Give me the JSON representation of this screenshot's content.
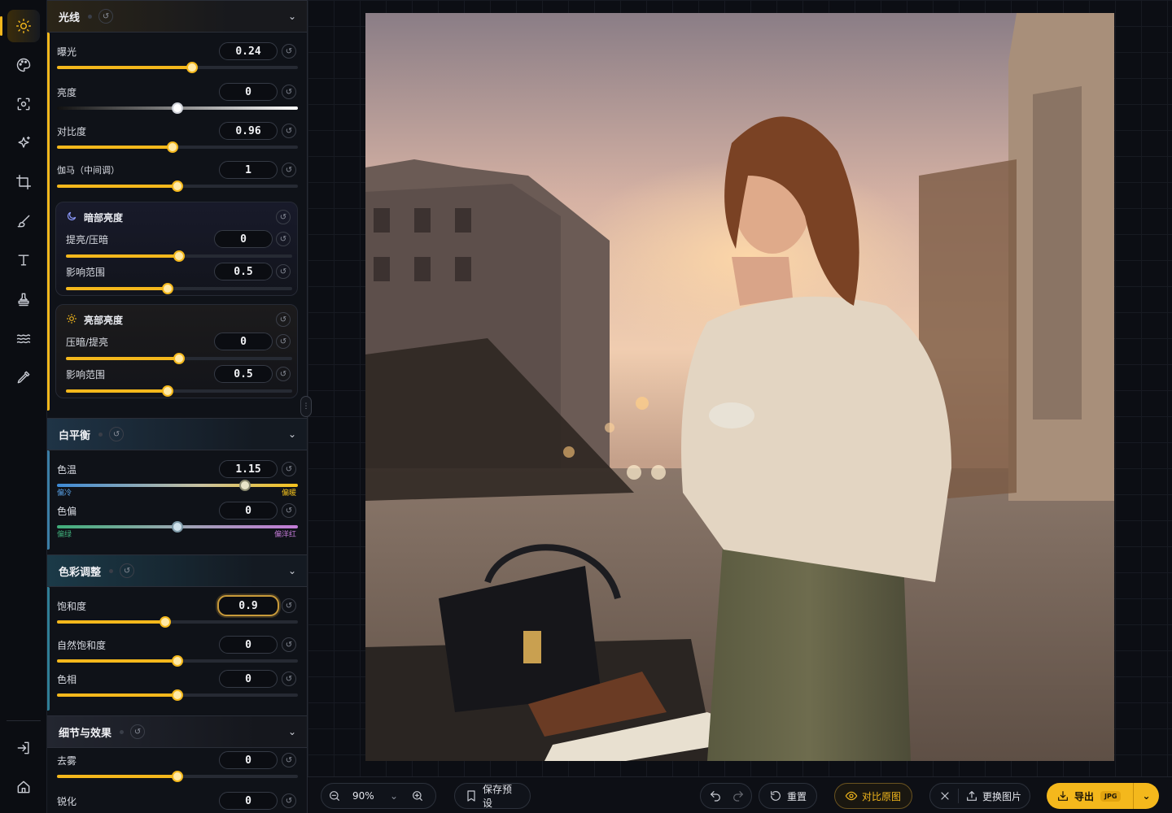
{
  "rail": {
    "tools": [
      "sun-icon",
      "palette-icon",
      "focus-icon",
      "sparkle-icon",
      "crop-icon",
      "brush-icon",
      "text-icon",
      "stamp-icon",
      "waves-icon",
      "eyedropper-icon"
    ],
    "bottom": [
      "exit-icon",
      "home-icon"
    ]
  },
  "light": {
    "title": "光线",
    "exposure": {
      "label": "曝光",
      "value": "0.24",
      "level": 0.56
    },
    "brightness": {
      "label": "亮度",
      "value": "0",
      "level": 0.5
    },
    "contrast": {
      "label": "对比度",
      "value": "0.96",
      "level": 0.48
    },
    "gamma": {
      "label": "伽马（中间调）",
      "value": "1",
      "level": 0.5
    },
    "shadows": {
      "title": "暗部亮度",
      "lift": {
        "label": "提亮/压暗",
        "value": "0",
        "level": 0.5
      },
      "range": {
        "label": "影响范围",
        "value": "0.5",
        "level": 0.45
      }
    },
    "highlights": {
      "title": "亮部亮度",
      "lift": {
        "label": "压暗/提亮",
        "value": "0",
        "level": 0.5
      },
      "range": {
        "label": "影响范围",
        "value": "0.5",
        "level": 0.45
      }
    }
  },
  "white_balance": {
    "title": "白平衡",
    "temperature": {
      "label": "色温",
      "value": "1.15",
      "level": 0.78,
      "min_label": "偏冷",
      "max_label": "偏暖"
    },
    "tint": {
      "label": "色偏",
      "value": "0",
      "level": 0.5,
      "min_label": "偏绿",
      "max_label": "偏洋红"
    }
  },
  "color": {
    "title": "色彩调整",
    "saturation": {
      "label": "饱和度",
      "value": "0.9",
      "level": 0.45
    },
    "vibrance": {
      "label": "自然饱和度",
      "value": "0",
      "level": 0.5
    },
    "hue": {
      "label": "色相",
      "value": "0",
      "level": 0.5
    }
  },
  "detail": {
    "title": "细节与效果",
    "dehaze": {
      "label": "去雾",
      "value": "0",
      "level": 0.5
    },
    "sharpen": {
      "label": "锐化",
      "value": "0"
    }
  },
  "toolbar": {
    "zoom": "90%",
    "save_preset": "保存预设",
    "reset": "重置",
    "compare": "对比原图",
    "replace": "更换图片",
    "export": "导出",
    "export_format": "JPG"
  },
  "colors": {
    "accent": "#f4b81c",
    "panel": "#0f1218",
    "bg": "#0c0e14"
  }
}
